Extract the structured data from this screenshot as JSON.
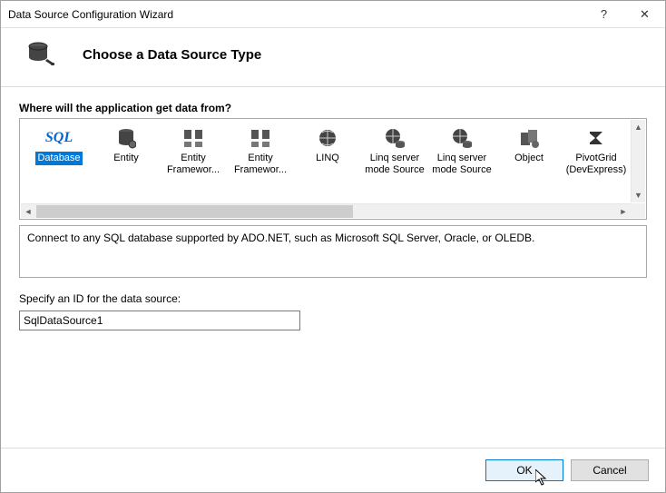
{
  "window": {
    "title": "Data Source Configuration Wizard",
    "help_label": "?",
    "close_label": "✕"
  },
  "header": {
    "title": "Choose a Data Source Type"
  },
  "source_section": {
    "label": "Where will the application get data from?"
  },
  "sources": [
    {
      "id": "database",
      "label": "Database",
      "icon_text": "SQL",
      "selected": true
    },
    {
      "id": "entity",
      "label": "Entity",
      "icon": "cylinder"
    },
    {
      "id": "ef1",
      "label": "Entity Framewor...",
      "icon": "ef"
    },
    {
      "id": "ef2",
      "label": "Entity Framewor...",
      "icon": "ef"
    },
    {
      "id": "linq",
      "label": "LINQ",
      "icon": "globe"
    },
    {
      "id": "linqserver1",
      "label": "Linq server mode Source",
      "icon": "globe-db1"
    },
    {
      "id": "linqserver2",
      "label": "Linq server mode Source",
      "icon": "globe-db2"
    },
    {
      "id": "object",
      "label": "Object",
      "icon": "object"
    },
    {
      "id": "pivotgrid",
      "label": "PivotGrid (DevExpress)",
      "icon": "sigma"
    }
  ],
  "description": "Connect to any SQL database supported by ADO.NET, such as Microsoft SQL Server, Oracle, or OLEDB.",
  "id_section": {
    "label": "Specify an ID for the data source:",
    "value": "SqlDataSource1"
  },
  "footer": {
    "ok": "OK",
    "cancel": "Cancel"
  }
}
